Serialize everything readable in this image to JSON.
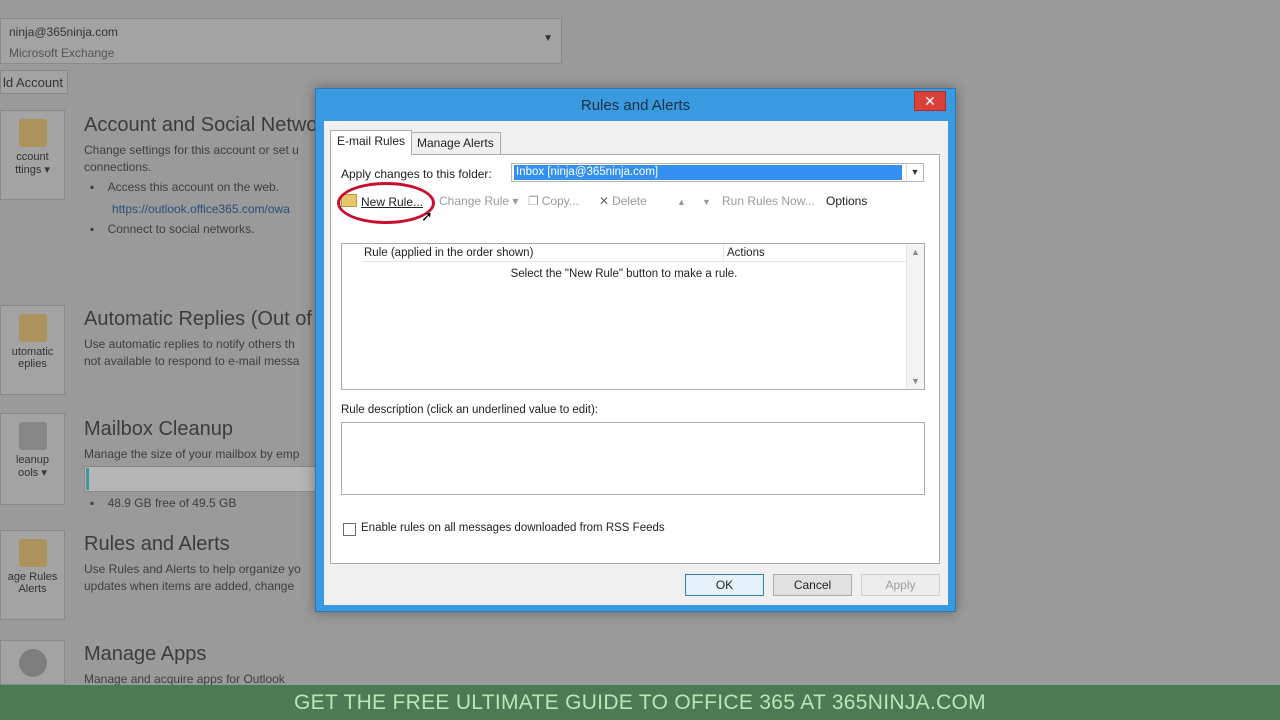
{
  "backdrop": {
    "account_email": "ninja@365ninja.com",
    "account_type": "Microsoft Exchange",
    "add_account": "ld Account",
    "tiles": [
      {
        "label": "ccount\nttings ▾"
      },
      {
        "label": "utomatic\neplies"
      },
      {
        "label": "leanup\nools ▾"
      },
      {
        "label": "age Rules\nAlerts"
      },
      {
        "label": ""
      }
    ],
    "sections": {
      "account": {
        "title": "Account and Social Netwo",
        "line1": "Change settings for this account or set u",
        "line2": "connections.",
        "bullet1": "Access this account on the web.",
        "link": "https://outlook.office365.com/owa",
        "bullet2": "Connect to social networks."
      },
      "auto_replies": {
        "title": "Automatic Replies (Out of",
        "line1": "Use automatic replies to notify others th",
        "line2": "not available to respond to e-mail messa"
      },
      "cleanup": {
        "title": "Mailbox Cleanup",
        "line1": "Manage the size of your mailbox by emp",
        "storage": "48.9 GB free of 49.5 GB",
        "usage_fraction": 0.012
      },
      "rules": {
        "title": "Rules and Alerts",
        "line1": "Use Rules and Alerts to help organize yo",
        "line2": "updates when items are added, change"
      },
      "apps": {
        "title": "Manage Apps",
        "line1": "Manage and acquire apps for Outlook"
      }
    }
  },
  "banner": {
    "text": "GET THE FREE ULTIMATE GUIDE TO OFFICE 365 AT 365NINJA.COM"
  },
  "dialog": {
    "title": "Rules and Alerts",
    "close_glyph": "✕",
    "tabs": [
      "E-mail Rules",
      "Manage Alerts"
    ],
    "apply_label": "Apply changes to this folder:",
    "folder_value": "Inbox [ninja@365ninja.com]",
    "toolbar": {
      "new_rule": "New Rule...",
      "change_rule": "Change Rule ▾",
      "copy": "Copy...",
      "delete": "Delete",
      "up": "▲",
      "down": "▼",
      "run_rules": "Run Rules Now...",
      "options": "Options"
    },
    "columns": [
      "Rule (applied in the order shown)",
      "Actions"
    ],
    "empty_message": "Select the \"New Rule\" button to make a rule.",
    "description_label": "Rule description (click an underlined value to edit):",
    "rss_label": "Enable rules on all messages downloaded from RSS Feeds",
    "rss_checked": false,
    "buttons": {
      "ok": "OK",
      "cancel": "Cancel",
      "apply": "Apply"
    }
  }
}
